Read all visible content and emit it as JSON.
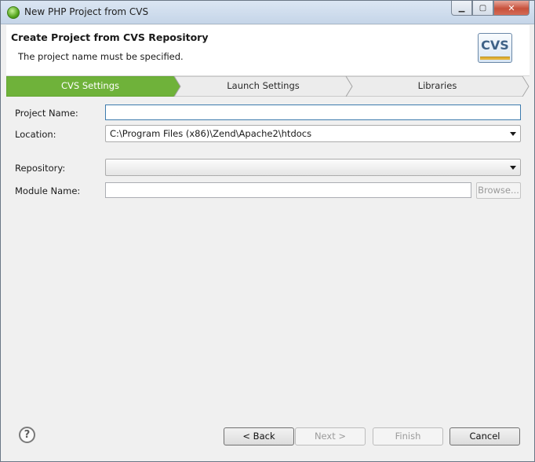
{
  "window": {
    "title": "New PHP Project from CVS"
  },
  "banner": {
    "title": "Create Project from CVS Repository",
    "message": "The project name must be specified.",
    "logo_text": "CVS"
  },
  "steps": [
    {
      "label": "CVS Settings",
      "active": true
    },
    {
      "label": "Launch Settings",
      "active": false
    },
    {
      "label": "Libraries",
      "active": false
    }
  ],
  "form": {
    "project_name_label": "Project Name:",
    "project_name_value": "",
    "location_label": "Location:",
    "location_value": "C:\\Program Files (x86)\\Zend\\Apache2\\htdocs",
    "repository_label": "Repository:",
    "repository_value": "",
    "module_name_label": "Module Name:",
    "module_name_value": "",
    "browse_label": "Browse..."
  },
  "buttons": {
    "back": "< Back",
    "next": "Next >",
    "finish": "Finish",
    "cancel": "Cancel"
  },
  "colors": {
    "step_active": "#6fb23a",
    "step_inactive": "#ececec"
  }
}
